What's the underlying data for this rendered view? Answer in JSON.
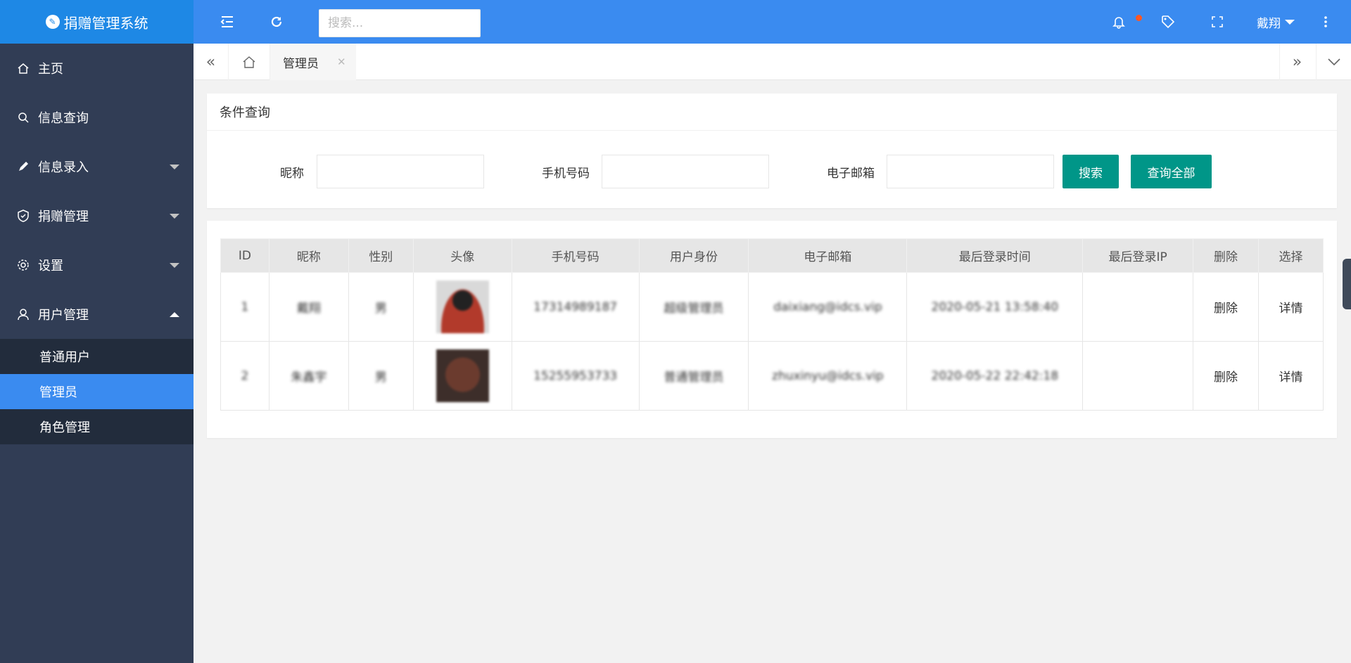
{
  "app": {
    "title": "捐赠管理系统"
  },
  "header": {
    "search_placeholder": "搜索...",
    "user_name": "戴翔"
  },
  "sidebar": {
    "items": [
      {
        "label": "主页",
        "icon": "home-icon"
      },
      {
        "label": "信息查询",
        "icon": "search-icon"
      },
      {
        "label": "信息录入",
        "icon": "pencil-icon"
      },
      {
        "label": "捐赠管理",
        "icon": "shield-icon"
      },
      {
        "label": "设置",
        "icon": "gear-icon"
      },
      {
        "label": "用户管理",
        "icon": "user-icon"
      }
    ],
    "sub_items": [
      {
        "label": "普通用户"
      },
      {
        "label": "管理员"
      },
      {
        "label": "角色管理"
      }
    ]
  },
  "tabs": {
    "active_label": "管理员"
  },
  "search_form": {
    "title": "条件查询",
    "nickname_label": "昵称",
    "phone_label": "手机号码",
    "email_label": "电子邮箱",
    "search_button": "搜索",
    "query_all_button": "查询全部"
  },
  "table": {
    "columns": [
      "ID",
      "昵称",
      "性别",
      "头像",
      "手机号码",
      "用户身份",
      "电子邮箱",
      "最后登录时间",
      "最后登录IP",
      "删除",
      "选择"
    ],
    "rows": [
      {
        "id": "1",
        "nickname": "戴翔",
        "gender": "男",
        "phone": "17314989187",
        "role": "超级管理员",
        "email": "daixiang@idcs.vip",
        "last_login": "2020-05-21 13:58:40",
        "last_ip": "",
        "delete": "删除",
        "select": "详情"
      },
      {
        "id": "2",
        "nickname": "朱鑫宇",
        "gender": "男",
        "phone": "15255953733",
        "role": "普通管理员",
        "email": "zhuxinyu@idcs.vip",
        "last_login": "2020-05-22 22:42:18",
        "last_ip": "",
        "delete": "删除",
        "select": "详情"
      }
    ]
  },
  "colors": {
    "header_bg": "#3a8bf0",
    "logo_bg": "#1e88e5",
    "sidebar_bg": "#313d55",
    "submenu_bg": "#222c3c",
    "active_item": "#3a8bf0",
    "button_green": "#009688",
    "notify_dot": "#ff5722"
  }
}
